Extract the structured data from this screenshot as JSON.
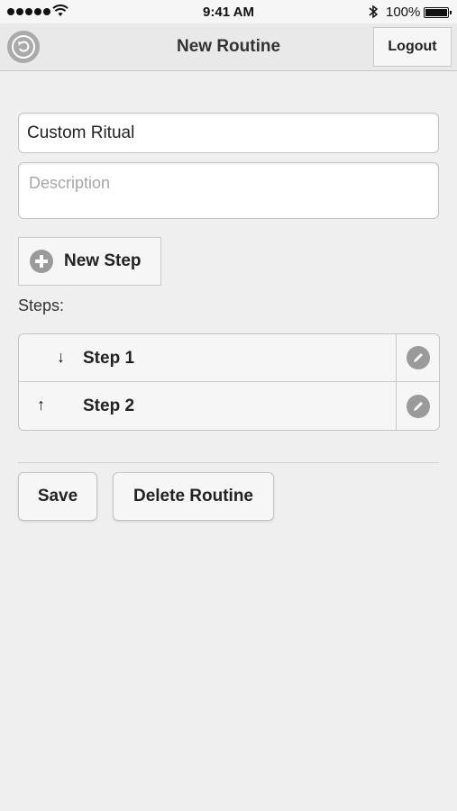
{
  "status_bar": {
    "time": "9:41 AM",
    "battery": "100%",
    "icons": [
      "signal-dots-icon",
      "wifi-icon",
      "bluetooth-icon",
      "battery-icon"
    ]
  },
  "header": {
    "title": "New Routine",
    "logout_label": "Logout",
    "back_icon": "back-icon"
  },
  "form": {
    "name_value": "Custom Ritual",
    "description_placeholder": "Description",
    "new_step_label": "New Step",
    "steps_label": "Steps:"
  },
  "steps": [
    {
      "label": "Step 1",
      "arrow": "↓",
      "arrow_icon": "arrow-down-icon"
    },
    {
      "label": "Step 2",
      "arrow": "↑",
      "arrow_icon": "arrow-up-icon"
    }
  ],
  "actions": {
    "save_label": "Save",
    "delete_label": "Delete Routine"
  },
  "colors": {
    "background": "#eeefee",
    "header": "#e8e9e8",
    "button": "#f6f6f6",
    "icon_gray": "#9a9a9a",
    "placeholder": "#a6a6a6"
  }
}
